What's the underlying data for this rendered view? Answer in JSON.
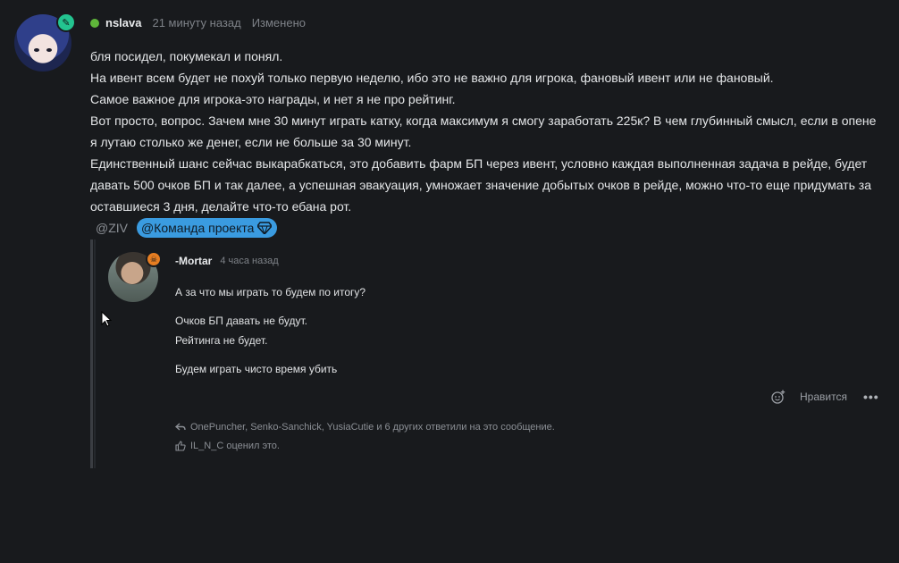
{
  "post": {
    "username": "nslava",
    "time": "21 минуту назад",
    "edited": "Изменено",
    "lines": [
      "бля посидел, покумекал и понял.",
      "На ивент всем будет не похуй только первую неделю, ибо это не важно для игрока, фановый ивент или не фановый.",
      "Самое важное для игрока-это награды, и нет я не про рейтинг.",
      "Вот просто, вопрос. Зачем мне 30 минут играть катку, когда максимум я смогу заработать 225к? В чем глубинный смысл, если в опене я лутаю столько же денег, если не больше за 30 минут.",
      "Единственный шанс сейчас выкарабкаться, это добавить фарм БП через ивент, условно каждая выполненная задача в рейде, будет давать 500 очков БП и так далее, а успешная эвакуация, умножает значение добытых очков в рейде, можно что-то еще придумать за оставшиеся 3 дня, делайте что-то ебана рот."
    ],
    "mention_plain": "@ZIV",
    "mention_team": "@Команда проекта"
  },
  "reply": {
    "username": "-Mortar",
    "time": "4 часа назад",
    "lines": {
      "q": "А за что мы играть то будем по итогу?",
      "a1": "Очков БП давать не будут.",
      "a2": "Рейтинга не будет.",
      "a3": "Будем играть чисто время убить"
    },
    "like_label": "Нравится",
    "more": "•••",
    "replies_summary": "OnePuncher, Senko-Sanchick, YusiaCutie и 6 других ответили на это сообщение.",
    "liked_summary": "IL_N_C оценил это."
  },
  "colors": {
    "background": "#181a1d",
    "online": "#5fb63a",
    "team_badge": "#3a9be0",
    "badge_green": "#23c490",
    "badge_orange": "#e67e22"
  }
}
